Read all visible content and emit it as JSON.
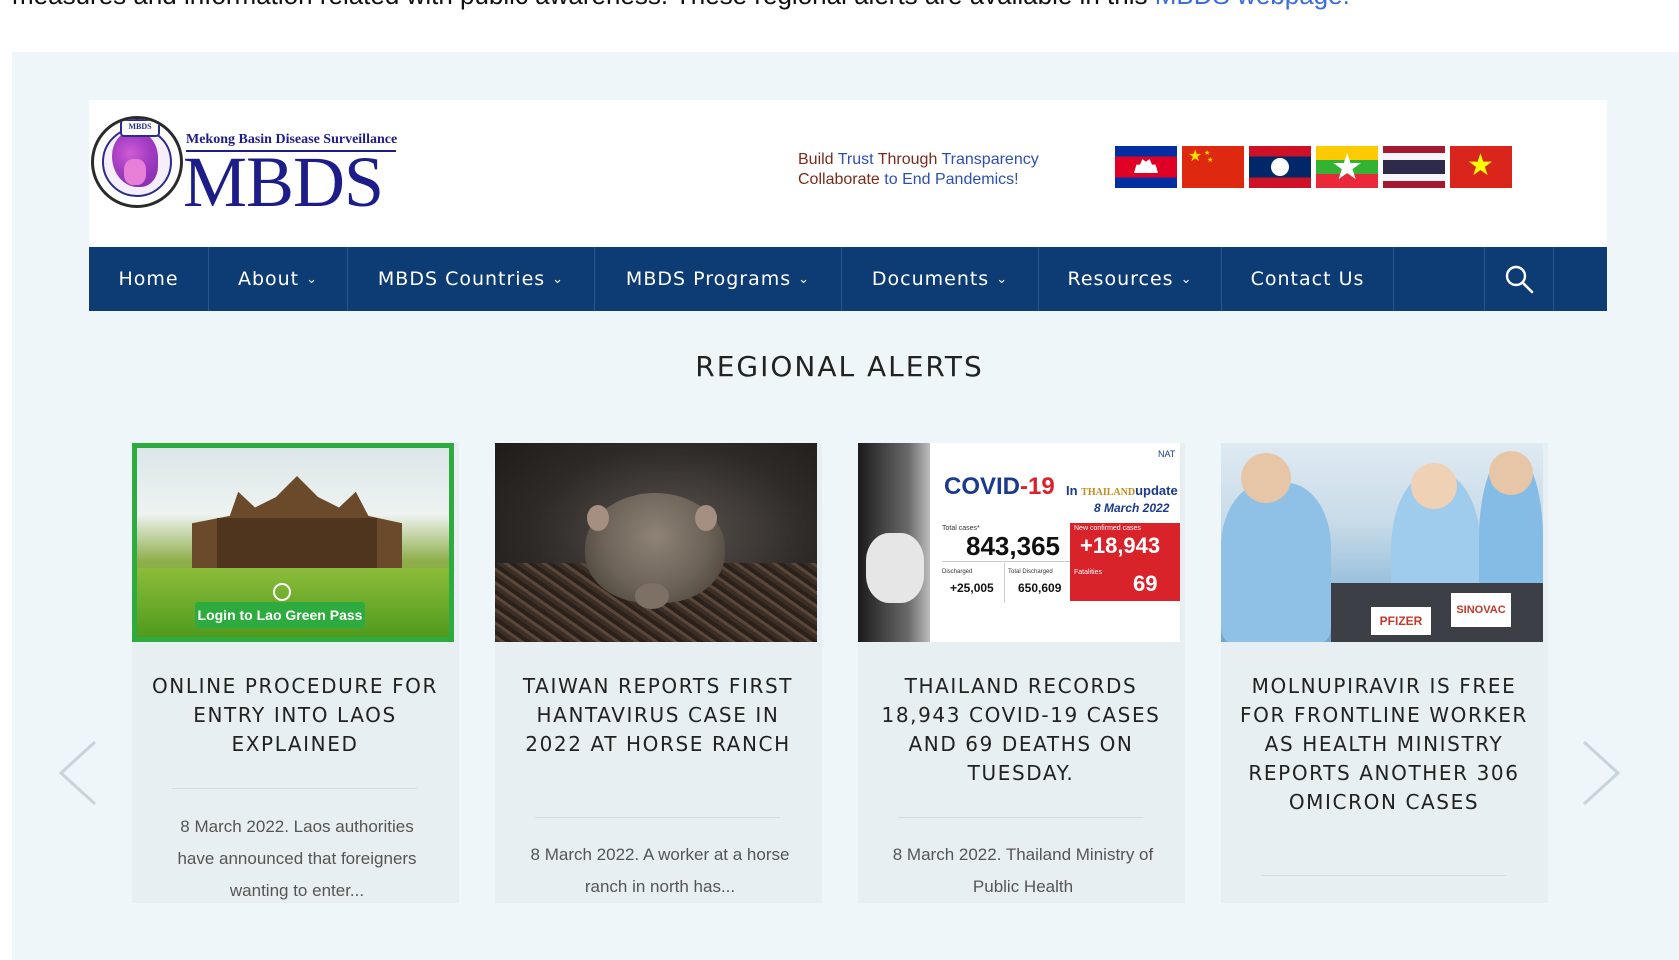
{
  "intro": {
    "text": "measures and information related with public awareness. These regional alerts are available in this ",
    "link": "MBDS webpage."
  },
  "logo": {
    "ribbon": "MBDS",
    "subtitle": "Mekong Basin Disease Surveillance",
    "title": "MBDS"
  },
  "slogan": {
    "l1a": "Build ",
    "l1b": "Trust",
    "l1c": " Through ",
    "l1d": "Transparency",
    "l2a": "Collaborate ",
    "l2b": "to End Pandemics!"
  },
  "flags": [
    "cambodia-flag-icon",
    "china-flag-icon",
    "laos-flag-icon",
    "myanmar-flag-icon",
    "thailand-flag-icon",
    "vietnam-flag-icon"
  ],
  "nav": {
    "home": "Home",
    "about": "About",
    "countries": "MBDS Countries",
    "programs": "MBDS Programs",
    "documents": "Documents",
    "resources": "Resources",
    "contact": "Contact Us",
    "chevron": "⌄"
  },
  "section_title": "REGIONAL ALERTS",
  "cards": [
    {
      "image_caption": "Login to Lao Green Pass",
      "title": "ONLINE PROCEDURE FOR ENTRY INTO LAOS EXPLAINED",
      "excerpt": "8 March 2022. Laos authorities have announced that foreigners wanting to enter..."
    },
    {
      "title": "TAIWAN REPORTS FIRST HANTAVIRUS CASE IN 2022 AT HORSE RANCH",
      "excerpt": "8 March 2022. A worker at a horse ranch in north has..."
    },
    {
      "image_text": {
        "covid": "COVID",
        "dash19": "-19",
        "in": "In ",
        "thailand": "THAILAND",
        "update": "update",
        "date": "8 March 2022",
        "nat": "NAT",
        "total_label": "Total cases*",
        "total": "843,365",
        "new_label": "New confirmed cases",
        "new": "+18,943",
        "fatal_label": "Fatalities",
        "fatal": "69",
        "discharged_label": "Discharged",
        "discharged": "+25,005",
        "total_discharged_label": "Total Discharged",
        "total_discharged": "650,609"
      },
      "title": "THAILAND RECORDS 18,943 COVID-19 CASES AND 69 DEATHS ON TUESDAY.",
      "excerpt": "8 March 2022. Thailand Ministry of Public Health"
    },
    {
      "image_labels": [
        "PFIZER",
        "SINOVAC"
      ],
      "title": "MOLNUPIRAVIR IS FREE FOR FRONTLINE WORKER AS HEALTH MINISTRY REPORTS ANOTHER 306 OMICRON CASES",
      "excerpt": ""
    }
  ],
  "colors": {
    "nav_bg": "#0d3b73",
    "panel_bg": "#eef6fa",
    "card_bg": "#e7eff3",
    "link": "#3c6cd9",
    "green_pass": "#2eab3f"
  }
}
